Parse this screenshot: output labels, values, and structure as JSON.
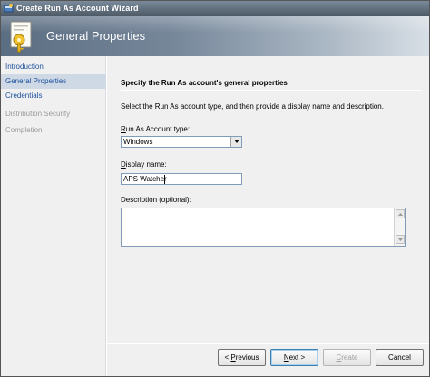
{
  "window": {
    "title": "Create Run As Account Wizard"
  },
  "banner": {
    "title": "General Properties",
    "icon": "key-icon"
  },
  "nav": {
    "items": [
      {
        "label": "Introduction",
        "state": "normal"
      },
      {
        "label": "General Properties",
        "state": "active"
      },
      {
        "label": "Credentials",
        "state": "normal"
      },
      {
        "label": "Distribution Security",
        "state": "disabled"
      },
      {
        "label": "Completion",
        "state": "disabled"
      }
    ]
  },
  "main": {
    "heading": "Specify the Run As account's general properties",
    "instructions": "Select the Run As account type, and then provide a display name and description.",
    "account_type": {
      "label_prefix": "",
      "label_access": "R",
      "label_rest": "un As Account type:",
      "value": "Windows"
    },
    "display_name": {
      "label_access": "D",
      "label_rest": "isplay name:",
      "value": "APS Watcher"
    },
    "description": {
      "label": "Description (optional):",
      "value": ""
    }
  },
  "footer": {
    "previous": {
      "prefix": "< ",
      "access": "P",
      "rest": "revious"
    },
    "next": {
      "access": "N",
      "rest": "ext >"
    },
    "create": {
      "access": "C",
      "rest": "reate"
    },
    "cancel": {
      "label": "Cancel"
    }
  },
  "colors": {
    "nav_link": "#1a4f9c",
    "nav_active_bg": "#ced9e5",
    "disabled": "#9a9a9a",
    "banner_dark": "#5b6d82"
  }
}
